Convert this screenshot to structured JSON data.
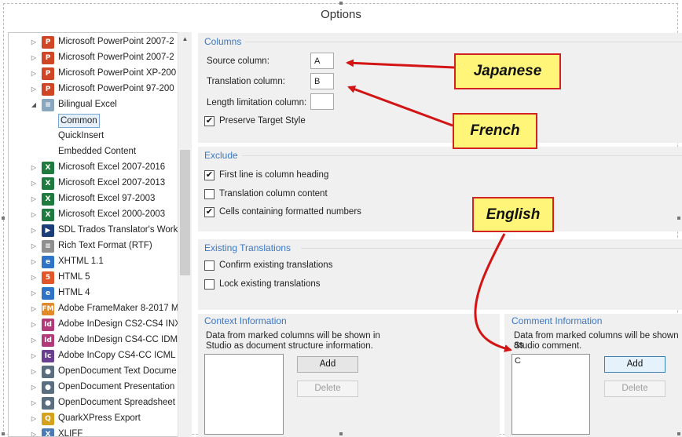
{
  "window": {
    "title": "Options"
  },
  "tree": {
    "items": [
      {
        "label": "Microsoft PowerPoint 2007-2",
        "icon": "P",
        "color": "#d04525",
        "expand": "collapsed",
        "level": 1,
        "name": "powerpoint-icon"
      },
      {
        "label": "Microsoft PowerPoint 2007-2",
        "icon": "P",
        "color": "#d04525",
        "expand": "collapsed",
        "level": 1,
        "name": "powerpoint-icon"
      },
      {
        "label": "Microsoft PowerPoint XP-200",
        "icon": "P",
        "color": "#d04525",
        "expand": "collapsed",
        "level": 1,
        "name": "powerpoint-icon"
      },
      {
        "label": "Microsoft PowerPoint 97-200",
        "icon": "P",
        "color": "#d04525",
        "expand": "collapsed",
        "level": 1,
        "name": "powerpoint-icon"
      },
      {
        "label": "Bilingual Excel",
        "icon": "≡",
        "color": "#8aa7c0",
        "expand": "expanded",
        "level": 1,
        "name": "bilingual-excel-icon"
      },
      {
        "label": "Common",
        "icon": "",
        "color": "",
        "expand": "none",
        "level": 2,
        "selected": true,
        "name": ""
      },
      {
        "label": "QuickInsert",
        "icon": "",
        "color": "",
        "expand": "none",
        "level": 2,
        "name": ""
      },
      {
        "label": "Embedded Content",
        "icon": "",
        "color": "",
        "expand": "none",
        "level": 2,
        "name": ""
      },
      {
        "label": "Microsoft Excel 2007-2016",
        "icon": "X",
        "color": "#1f7a3f",
        "expand": "collapsed",
        "level": 1,
        "name": "excel-icon"
      },
      {
        "label": "Microsoft Excel 2007-2013",
        "icon": "X",
        "color": "#1f7a3f",
        "expand": "collapsed",
        "level": 1,
        "name": "excel-icon"
      },
      {
        "label": "Microsoft Excel 97-2003",
        "icon": "X",
        "color": "#1f7a3f",
        "expand": "collapsed",
        "level": 1,
        "name": "excel-icon"
      },
      {
        "label": "Microsoft Excel 2000-2003",
        "icon": "X",
        "color": "#1f7a3f",
        "expand": "collapsed",
        "level": 1,
        "name": "excel-icon"
      },
      {
        "label": "SDL Trados Translator's Work",
        "icon": "▶",
        "color": "#1b3d78",
        "expand": "collapsed",
        "level": 1,
        "name": "trados-icon"
      },
      {
        "label": "Rich Text Format (RTF)",
        "icon": "≡",
        "color": "#8f8f8f",
        "expand": "collapsed",
        "level": 1,
        "name": "rtf-icon"
      },
      {
        "label": "XHTML 1.1",
        "icon": "e",
        "color": "#2f74c6",
        "expand": "collapsed",
        "level": 1,
        "name": "xhtml-icon"
      },
      {
        "label": "HTML 5",
        "icon": "5",
        "color": "#e2572a",
        "expand": "collapsed",
        "level": 1,
        "name": "html5-icon"
      },
      {
        "label": "HTML 4",
        "icon": "e",
        "color": "#2f74c6",
        "expand": "collapsed",
        "level": 1,
        "name": "html4-icon"
      },
      {
        "label": "Adobe FrameMaker 8-2017 M",
        "icon": "FM",
        "color": "#e28a2a",
        "expand": "collapsed",
        "level": 1,
        "name": "framemaker-icon"
      },
      {
        "label": "Adobe InDesign CS2-CS4 INX",
        "icon": "Id",
        "color": "#b33a78",
        "expand": "collapsed",
        "level": 1,
        "name": "indesign-icon"
      },
      {
        "label": "Adobe InDesign CS4-CC IDM",
        "icon": "Id",
        "color": "#b33a78",
        "expand": "collapsed",
        "level": 1,
        "name": "indesign-icon"
      },
      {
        "label": "Adobe InCopy CS4-CC ICML",
        "icon": "Ic",
        "color": "#6b3f8f",
        "expand": "collapsed",
        "level": 1,
        "name": "incopy-icon"
      },
      {
        "label": "OpenDocument Text Docume",
        "icon": "●",
        "color": "#5a6e80",
        "expand": "collapsed",
        "level": 1,
        "name": "opendocument-icon"
      },
      {
        "label": "OpenDocument Presentation",
        "icon": "●",
        "color": "#5a6e80",
        "expand": "collapsed",
        "level": 1,
        "name": "opendocument-icon"
      },
      {
        "label": "OpenDocument Spreadsheet",
        "icon": "●",
        "color": "#5a6e80",
        "expand": "collapsed",
        "level": 1,
        "name": "opendocument-icon"
      },
      {
        "label": "QuarkXPress Export",
        "icon": "Q",
        "color": "#d6a21d",
        "expand": "collapsed",
        "level": 1,
        "name": "quark-icon"
      },
      {
        "label": "XLIFF",
        "icon": "X",
        "color": "#4b7bb5",
        "expand": "collapsed",
        "level": 1,
        "name": "xliff-icon"
      }
    ]
  },
  "columns": {
    "title": "Columns",
    "source_label": "Source column:",
    "source_value": "A",
    "translation_label": "Translation column:",
    "translation_value": "B",
    "length_label": "Length limitation column:",
    "length_value": "",
    "preserve_label": "Preserve Target Style",
    "preserve_checked": true
  },
  "exclude": {
    "title": "Exclude",
    "first_line_label": "First line is column heading",
    "first_line_checked": true,
    "translation_content_label": "Translation column content",
    "translation_content_checked": false,
    "formatted_numbers_label": "Cells containing formatted numbers",
    "formatted_numbers_checked": true
  },
  "existing": {
    "title": "Existing Translations",
    "confirm_label": "Confirm existing translations",
    "confirm_checked": false,
    "lock_label": "Lock existing translations",
    "lock_checked": false
  },
  "context": {
    "title": "Context Information",
    "desc1": "Data from marked columns will be shown in",
    "desc2": "Studio as document structure information.",
    "add": "Add",
    "delete": "Delete"
  },
  "comment": {
    "title": "Comment Information",
    "desc1": "Data from marked columns will be shown as",
    "desc2": "Studio comment.",
    "list_value": "C",
    "add": "Add",
    "delete": "Delete"
  },
  "callouts": {
    "japanese": "Japanese",
    "french": "French",
    "english": "English"
  },
  "colors": {
    "accent": "#3b77c5",
    "callout_fill": "#fef579",
    "callout_border": "#d32222",
    "arrow": "#d31414"
  }
}
